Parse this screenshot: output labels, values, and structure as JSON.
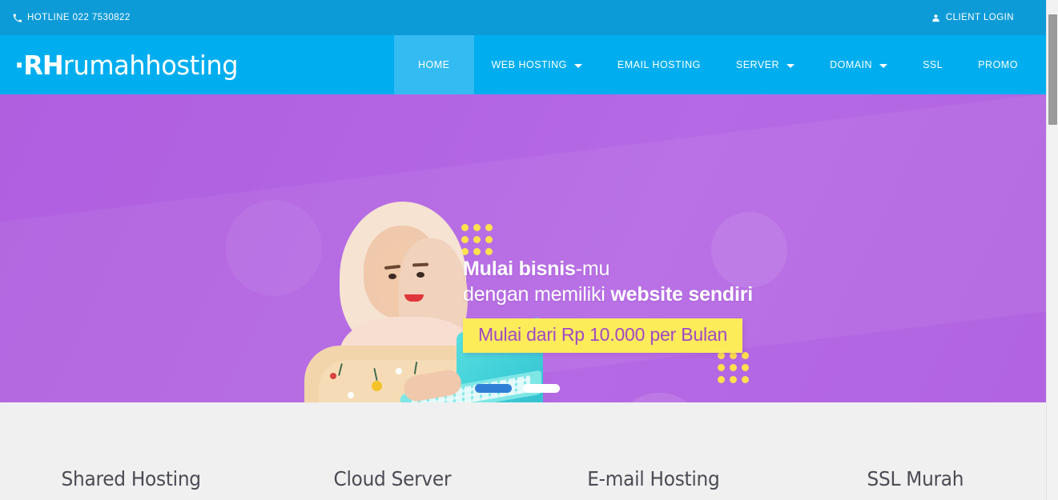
{
  "topbar": {
    "hotline": {
      "icon": "phone-icon",
      "label": "HOTLINE 022 7530822"
    },
    "client_login": {
      "icon": "user-icon",
      "label": "CLIENT LOGIN"
    },
    "bg_color": "#0d9bd8"
  },
  "header": {
    "logo_mark": "·RH",
    "logo_text": "rumahhosting",
    "bg_color": "#00aeef",
    "active_bg_color": "#33bbf2",
    "nav": [
      {
        "label": "HOME",
        "caret": false,
        "active": true
      },
      {
        "label": "WEB HOSTING",
        "caret": true,
        "active": false
      },
      {
        "label": "EMAIL HOSTING",
        "caret": false,
        "active": false
      },
      {
        "label": "SERVER",
        "caret": true,
        "active": false
      },
      {
        "label": "DOMAIN",
        "caret": true,
        "active": false
      },
      {
        "label": "SSL",
        "caret": false,
        "active": false
      },
      {
        "label": "PROMO",
        "caret": false,
        "active": false
      }
    ]
  },
  "hero": {
    "bg_color": "#b264e2",
    "headline_part1_bold": "Mulai bisnis",
    "headline_part1_rest": "-mu",
    "headline_part2_pre": "dengan memiliki ",
    "headline_part2_bold": "website sendiri",
    "price_badge": "Mulai dari Rp 10.000 per Bulan",
    "price_bg_color": "#fdec5a",
    "price_text_color": "#a049c6",
    "dot_color": "#ffe14d",
    "image_alt": "woman-in-hijab-with-laptop",
    "carousel": [
      {
        "name": "slide-1",
        "active": true,
        "color": "#2f7fd6"
      },
      {
        "name": "slide-2",
        "active": false,
        "color": "#ffffff"
      }
    ]
  },
  "services": {
    "bg_color": "#f0f0f0",
    "items": [
      {
        "title": "Shared Hosting"
      },
      {
        "title": "Cloud Server"
      },
      {
        "title": "E-mail Hosting"
      },
      {
        "title": "SSL Murah"
      }
    ]
  },
  "scrollbar": {
    "orientation": "vertical",
    "thumb_color": "#9a9a9a",
    "track_color": "#f2f2f2"
  }
}
